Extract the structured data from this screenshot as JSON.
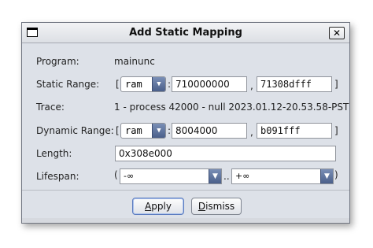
{
  "dialog": {
    "title": "Add Static Mapping",
    "close_glyph": "✕"
  },
  "program": {
    "label": "Program:",
    "value": "mainunc"
  },
  "static_range": {
    "label": "Static Range:",
    "open_bracket": "[",
    "space": "ram",
    "colon": ":",
    "start": "710000000",
    "separator": ",",
    "end": "71308dfff",
    "close_bracket": "]"
  },
  "trace": {
    "label": "Trace:",
    "value": "1 - process 42000 - null 2023.01.12-20.53.58-PST"
  },
  "dynamic_range": {
    "label": "Dynamic Range:",
    "open_bracket": "[",
    "space": "ram",
    "colon": ":",
    "start": "8004000",
    "separator": ",",
    "end": "b091fff",
    "close_bracket": "]"
  },
  "length": {
    "label": "Length:",
    "value": "0x308e000"
  },
  "lifespan": {
    "label": "Lifespan:",
    "open_paren": "(",
    "min": "-∞",
    "dots": "..",
    "max": "+∞",
    "close_paren": ")"
  },
  "buttons": {
    "apply_first": "A",
    "apply_rest": "pply",
    "dismiss_first": "D",
    "dismiss_rest": "ismiss"
  },
  "icons": {
    "dropdown": "chevron-down-icon",
    "window": "window-icon",
    "close": "close-icon"
  }
}
